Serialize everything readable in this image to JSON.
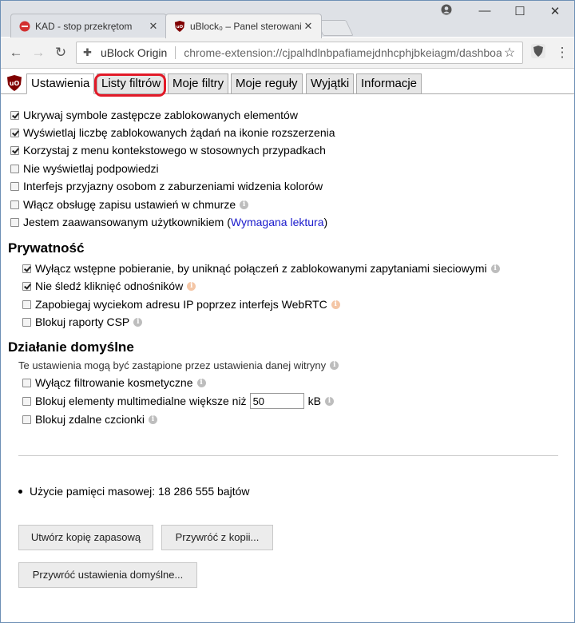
{
  "browser": {
    "tabs": [
      {
        "title": "KAD - stop przekrętom",
        "close": "✕"
      },
      {
        "title": "uBlock₀ – Panel sterowania",
        "close": "✕"
      }
    ],
    "window_controls": {
      "minimize": "—",
      "maximize": "☐",
      "close": "✕"
    },
    "address": {
      "site": "uBlock Origin",
      "url": "chrome-extension://cjpalhdlnbpafiamejdnhcphjbkeiagm/dashboard.html"
    }
  },
  "dashboard": {
    "tabs": [
      "Ustawienia",
      "Listy filtrów",
      "Moje filtry",
      "Moje reguły",
      "Wyjątki",
      "Informacje"
    ],
    "active_tab": "Ustawienia",
    "highlighted_tab": "Listy filtrów",
    "general": [
      {
        "label": "Ukrywaj symbole zastępcze zablokowanych elementów",
        "checked": true
      },
      {
        "label": "Wyświetlaj liczbę zablokowanych żądań na ikonie rozszerzenia",
        "checked": true
      },
      {
        "label": "Korzystaj z menu kontekstowego w stosownych przypadkach",
        "checked": true
      },
      {
        "label": "Nie wyświetlaj podpowiedzi",
        "checked": false
      },
      {
        "label": "Interfejs przyjazny osobom z zaburzeniami widzenia kolorów",
        "checked": false
      },
      {
        "label": "Włącz obsługę zapisu ustawień w chmurze",
        "checked": false
      },
      {
        "label": "Jestem zaawansowanym użytkownikiem",
        "link_prefix": "(",
        "link": "Wymagana lektura",
        "link_suffix": ")",
        "checked": false
      }
    ],
    "privacy": {
      "heading": "Prywatność",
      "items": [
        {
          "label": "Wyłącz wstępne pobieranie, by uniknąć połączeń z zablokowanymi zapytaniami sieciowymi",
          "checked": true
        },
        {
          "label": "Nie śledź kliknięć odnośników",
          "checked": true
        },
        {
          "label": "Zapobiegaj wyciekom adresu IP poprzez interfejs WebRTC",
          "checked": false
        },
        {
          "label": "Blokuj raporty CSP",
          "checked": false
        }
      ]
    },
    "defaults": {
      "heading": "Działanie domyślne",
      "note": "Te ustawienia mogą być zastąpione przez ustawienia danej witryny",
      "items": [
        {
          "label": "Wyłącz filtrowanie kosmetyczne",
          "checked": false
        },
        {
          "label": "Blokuj elementy multimedialne większe niż",
          "value": "50",
          "unit": "kB",
          "checked": false
        },
        {
          "label": "Blokuj zdalne czcionki",
          "checked": false
        }
      ]
    },
    "memory": "Użycie pamięci masowej: 18 286 555 bajtów",
    "buttons": {
      "backup": "Utwórz kopię zapasową",
      "restore": "Przywróć z kopii...",
      "reset": "Przywróć ustawienia domyślne..."
    },
    "colors": {
      "highlight": "#e21a28",
      "link": "#1a1acc",
      "logo": "#800000"
    }
  }
}
